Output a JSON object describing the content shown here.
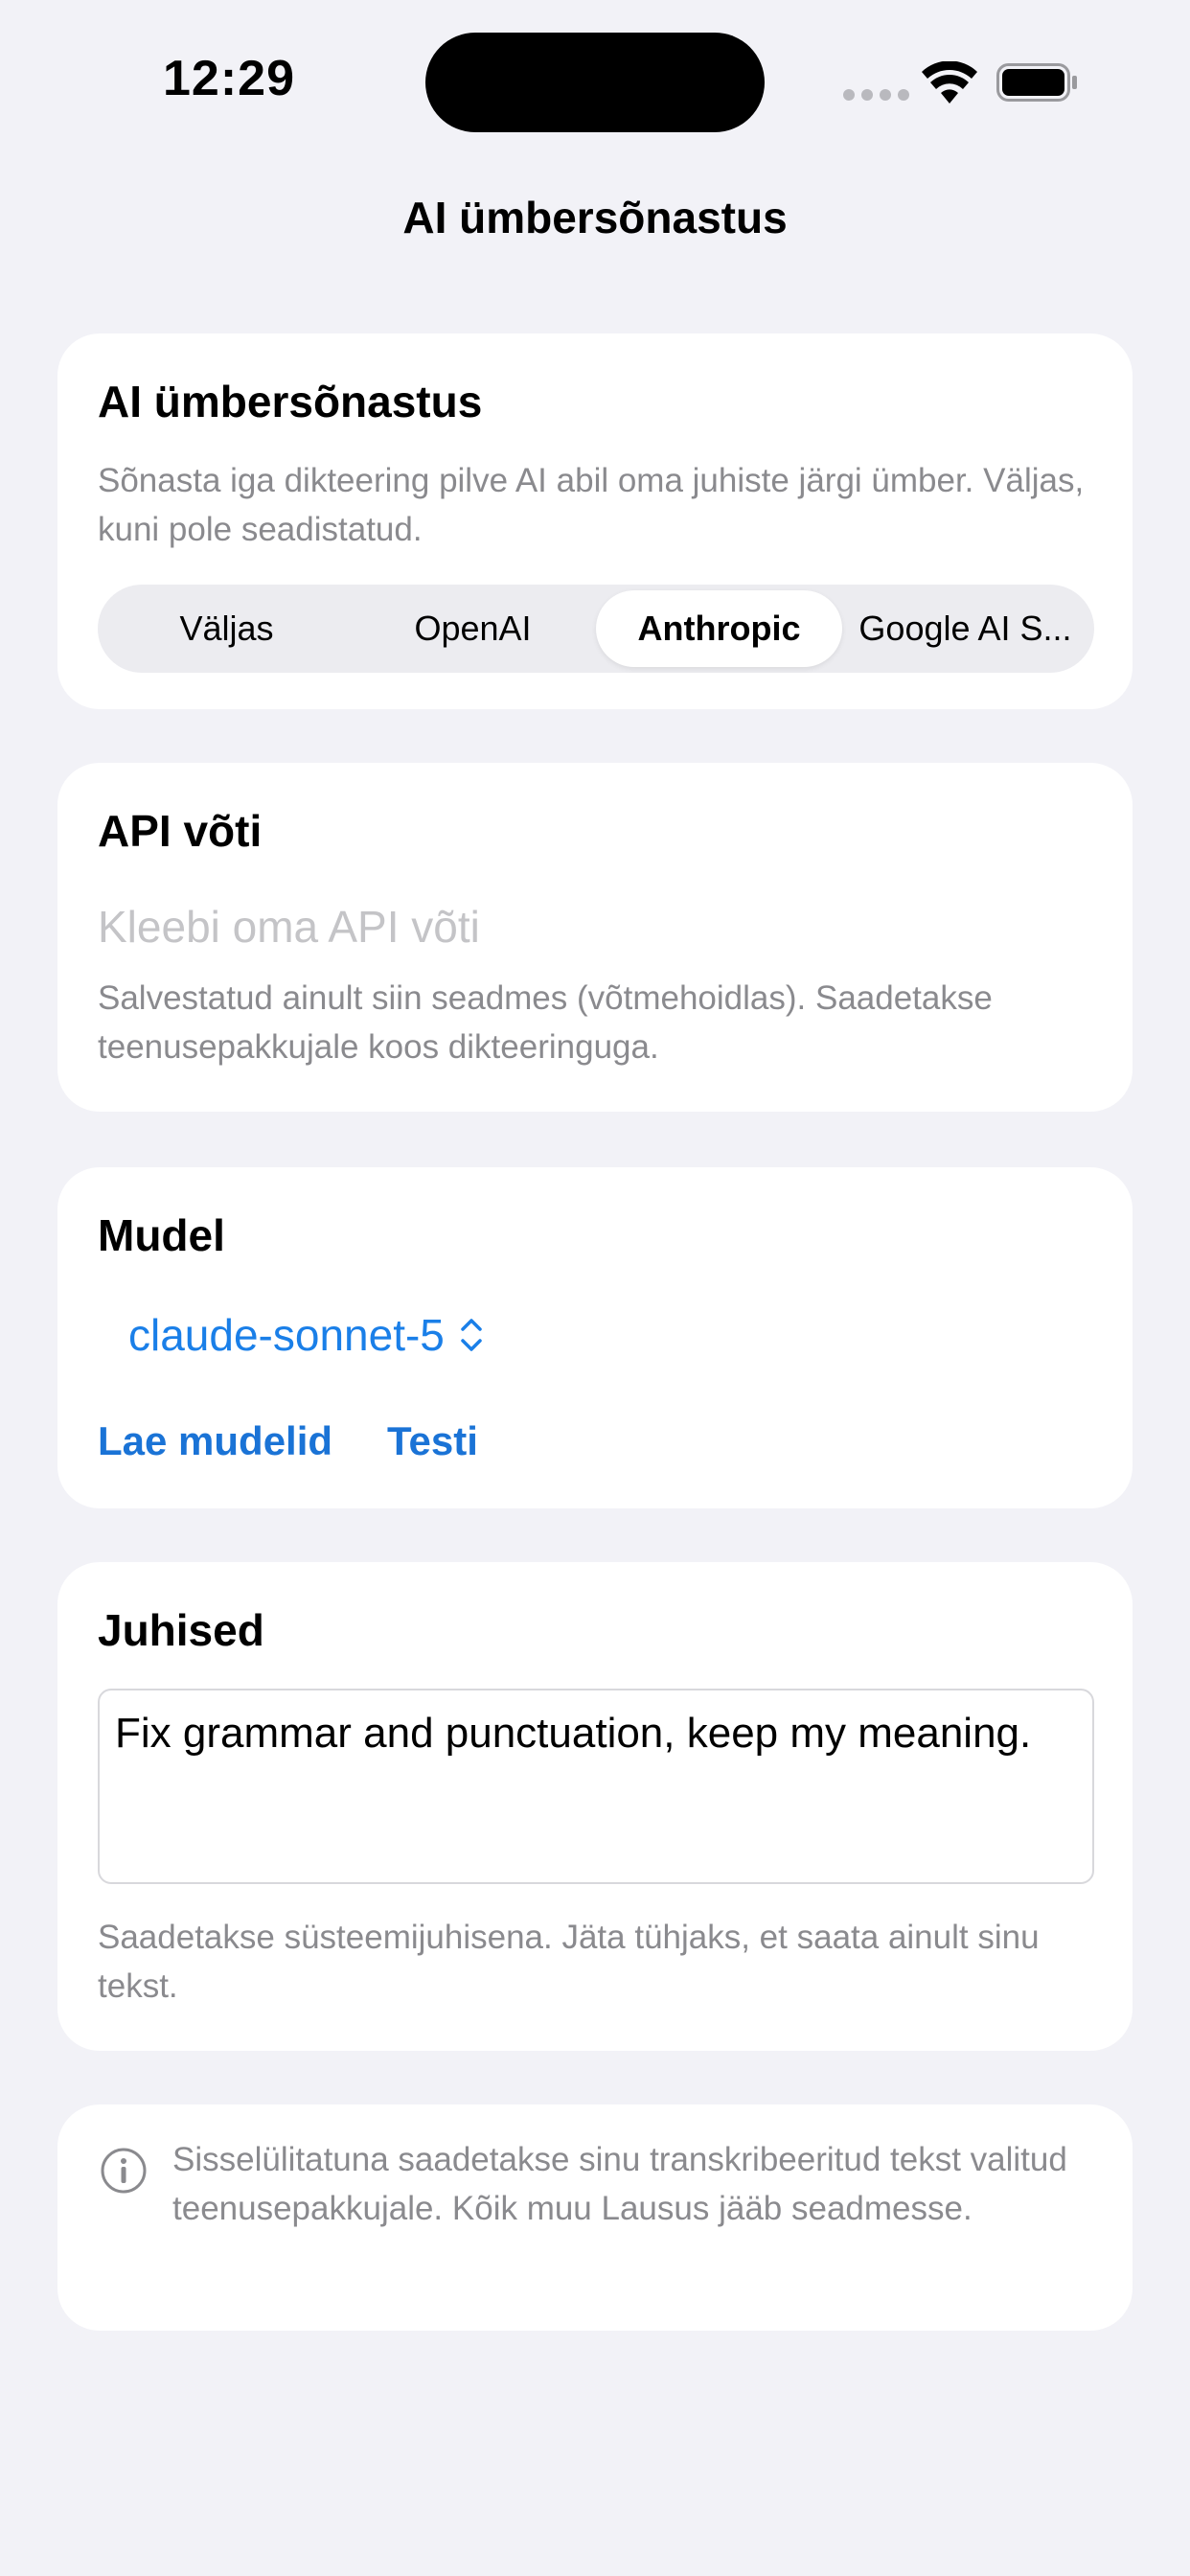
{
  "status_bar": {
    "time": "12:29"
  },
  "nav": {
    "title": "AI ümbersõnastus"
  },
  "provider_card": {
    "title": "AI ümbersõnastus",
    "description": "Sõnasta iga dikteering pilve AI abil oma juhiste järgi ümber. Väljas, kuni pole seadistatud.",
    "options": [
      "Väljas",
      "OpenAI",
      "Anthropic",
      "Google AI S..."
    ],
    "selected": "Anthropic"
  },
  "api_card": {
    "title": "API võti",
    "placeholder": "Kleebi oma API võti",
    "value": "",
    "footnote": "Salvestatud ainult siin seadmes (võtmehoidlas). Saadetakse teenusepakkujale koos dikteeringuga."
  },
  "model_card": {
    "title": "Mudel",
    "selected_model": "claude-sonnet-5",
    "load_models_label": "Lae mudelid",
    "test_label": "Testi"
  },
  "instructions_card": {
    "title": "Juhised",
    "value": "Fix grammar and punctuation, keep my meaning.",
    "footnote": "Saadetakse süsteemijuhisena. Jäta tühjaks, et saata ainult sinu tekst."
  },
  "info_card": {
    "icon": "info-icon",
    "text": "Sisselülitatuna saadetakse sinu transkribeeritud tekst valitud teenusepakkujale. Kõik muu Lausus jääb seadmesse."
  },
  "colors": {
    "accent": "#1a7fe8",
    "background": "#f2f2f7",
    "card": "#ffffff",
    "secondary_text": "#8a8a8e"
  }
}
